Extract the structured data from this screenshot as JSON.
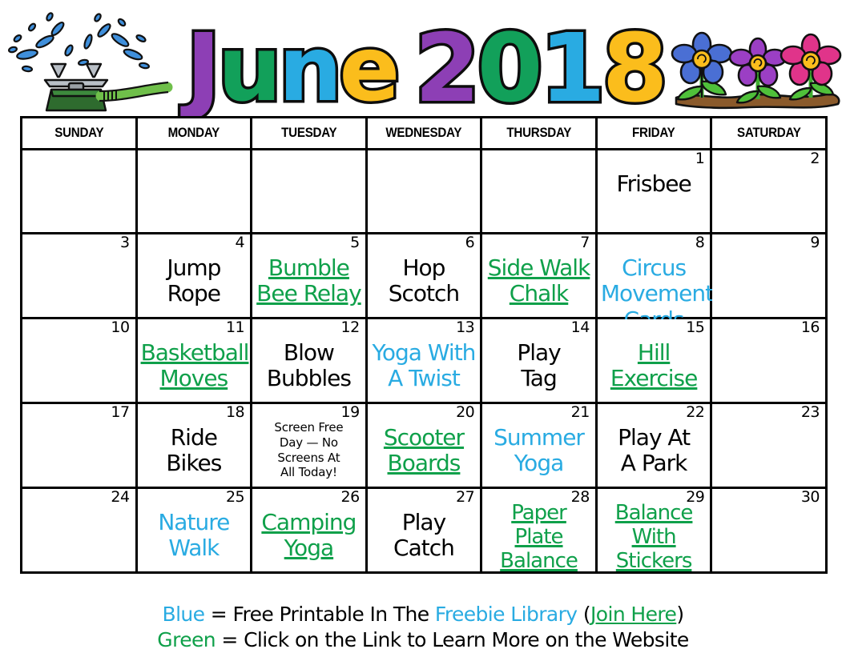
{
  "header": {
    "month": "June",
    "year": "2018",
    "title_letters": [
      {
        "ch": "J",
        "color": "#8d3fb5"
      },
      {
        "ch": "u",
        "color": "#12a05a"
      },
      {
        "ch": "n",
        "color": "#29abe2"
      },
      {
        "ch": "e",
        "color": "#fbbd1c"
      }
    ],
    "year_letters": [
      {
        "ch": "2",
        "color": "#8d3fb5"
      },
      {
        "ch": "0",
        "color": "#12a05a"
      },
      {
        "ch": "1",
        "color": "#29abe2"
      },
      {
        "ch": "8",
        "color": "#fbbd1c"
      }
    ],
    "decor_left": "sprinkler-illustration",
    "decor_right": "flowers-illustration"
  },
  "colors": {
    "blue": "#29abe2",
    "green": "#0fa04a",
    "black": "#000000",
    "border": "#000000",
    "flower_blue": "#4a6fd4",
    "flower_purple": "#9b3fc4",
    "flower_pink": "#e0348a",
    "flower_center": "#fbbd1c",
    "leaf_green": "#3fae30",
    "soil_brown": "#8a5a2b",
    "hose_green": "#6fbf4a",
    "sprinkler_body": "#2e6b2e",
    "water_blue": "#2f86d8",
    "metal_gray": "#9aa0a6"
  },
  "weekdays": [
    "SUNDAY",
    "MONDAY",
    "TUESDAY",
    "WEDNESDAY",
    "THURSDAY",
    "FRIDAY",
    "SATURDAY"
  ],
  "weeks": [
    [
      {
        "date": "",
        "lines": [],
        "color": ""
      },
      {
        "date": "",
        "lines": [],
        "color": ""
      },
      {
        "date": "",
        "lines": [],
        "color": ""
      },
      {
        "date": "",
        "lines": [],
        "color": ""
      },
      {
        "date": "",
        "lines": [],
        "color": ""
      },
      {
        "date": "1",
        "lines": [
          "Frisbee"
        ],
        "color": "black"
      },
      {
        "date": "2",
        "lines": [],
        "color": ""
      }
    ],
    [
      {
        "date": "3",
        "lines": [],
        "color": ""
      },
      {
        "date": "4",
        "lines": [
          "Jump",
          "Rope"
        ],
        "color": "black"
      },
      {
        "date": "5",
        "lines": [
          "Bumble",
          "Bee Relay"
        ],
        "color": "green"
      },
      {
        "date": "6",
        "lines": [
          "Hop",
          "Scotch"
        ],
        "color": "black"
      },
      {
        "date": "7",
        "lines": [
          "Side Walk",
          "Chalk"
        ],
        "color": "green"
      },
      {
        "date": "8",
        "lines": [
          "Circus",
          "Movement",
          "Cards"
        ],
        "color": "blue"
      },
      {
        "date": "9",
        "lines": [],
        "color": ""
      }
    ],
    [
      {
        "date": "10",
        "lines": [],
        "color": ""
      },
      {
        "date": "11",
        "lines": [
          "Basketball",
          "Moves"
        ],
        "color": "green"
      },
      {
        "date": "12",
        "lines": [
          "Blow",
          "Bubbles"
        ],
        "color": "black"
      },
      {
        "date": "13",
        "lines": [
          "Yoga With",
          "A Twist"
        ],
        "color": "blue"
      },
      {
        "date": "14",
        "lines": [
          "Play",
          "Tag"
        ],
        "color": "black"
      },
      {
        "date": "15",
        "lines": [
          "Hill",
          "Exercise"
        ],
        "color": "green"
      },
      {
        "date": "16",
        "lines": [],
        "color": ""
      }
    ],
    [
      {
        "date": "17",
        "lines": [],
        "color": ""
      },
      {
        "date": "18",
        "lines": [
          "Ride",
          "Bikes"
        ],
        "color": "black"
      },
      {
        "date": "19",
        "lines": [
          "Screen Free",
          "Day — No",
          "Screens At",
          "All Today!"
        ],
        "color": "black",
        "size": "small"
      },
      {
        "date": "20",
        "lines": [
          "Scooter",
          "Boards"
        ],
        "color": "green"
      },
      {
        "date": "21",
        "lines": [
          "Summer",
          "Yoga"
        ],
        "color": "blue"
      },
      {
        "date": "22",
        "lines": [
          "Play At",
          "A Park"
        ],
        "color": "black"
      },
      {
        "date": "23",
        "lines": [],
        "color": ""
      }
    ],
    [
      {
        "date": "24",
        "lines": [],
        "color": ""
      },
      {
        "date": "25",
        "lines": [
          "Nature",
          "Walk"
        ],
        "color": "blue"
      },
      {
        "date": "26",
        "lines": [
          "Camping",
          "Yoga"
        ],
        "color": "green"
      },
      {
        "date": "27",
        "lines": [
          "Play",
          "Catch"
        ],
        "color": "black"
      },
      {
        "date": "28",
        "lines": [
          "Paper",
          "Plate",
          "Balance"
        ],
        "color": "green",
        "size": "three"
      },
      {
        "date": "29",
        "lines": [
          "Balance",
          "With",
          "Stickers"
        ],
        "color": "green",
        "size": "three"
      },
      {
        "date": "30",
        "lines": [],
        "color": ""
      }
    ]
  ],
  "legend": {
    "line1": {
      "key": "Blue",
      "eq": " = ",
      "text_a": "Free Printable In The ",
      "highlight": "Freebie Library",
      "open_paren": " (",
      "link": "Join Here",
      "close_paren": ")"
    },
    "line2": {
      "key": "Green",
      "eq": " = ",
      "text": "Click on the Link to Learn More on the Website"
    }
  }
}
